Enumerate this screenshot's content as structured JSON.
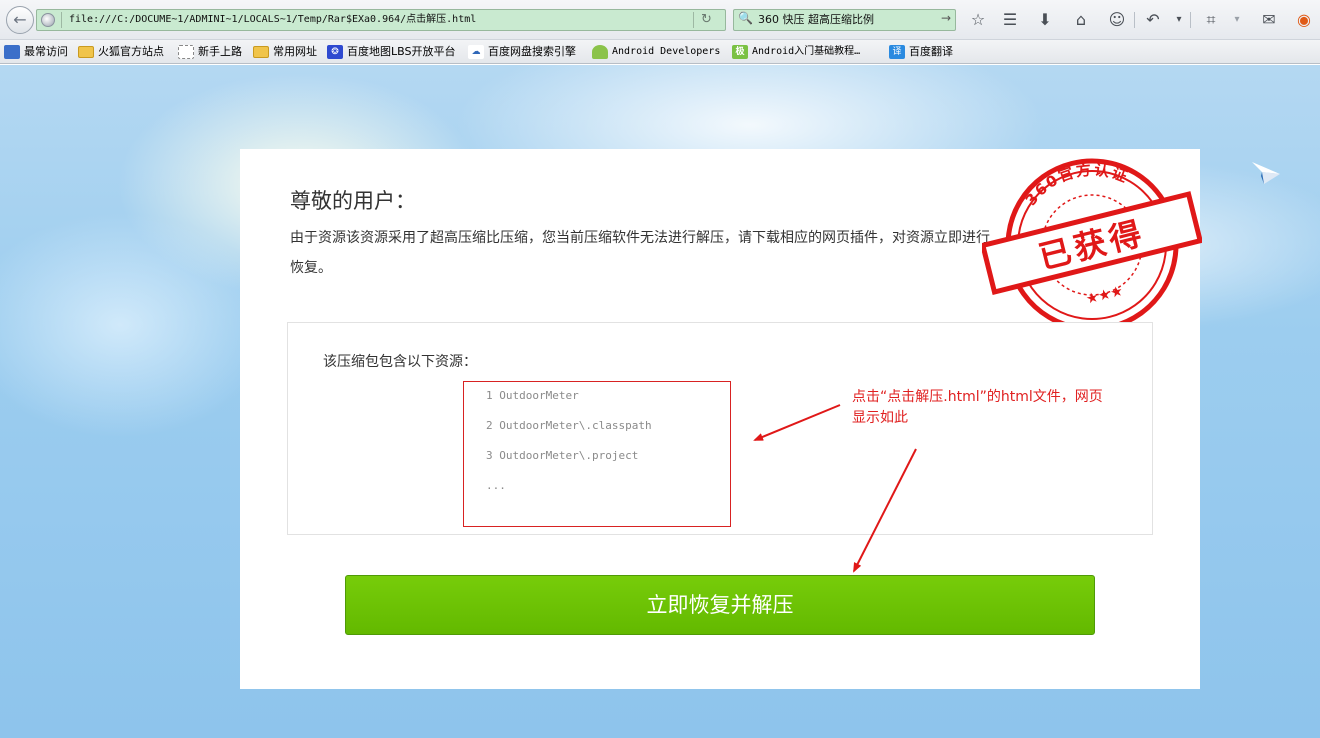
{
  "browser": {
    "url": "file:///C:/DOCUME~1/ADMINI~1/LOCALS~1/Temp/Rar$EXa0.964/点击解压.html",
    "search_text": "360 快压 超高压缩比例",
    "toolbar_icons": [
      "star-icon",
      "reader-icon",
      "download-icon",
      "home-icon",
      "chat-icon",
      "undo-icon",
      "crop-icon",
      "comment-icon",
      "weibo-icon"
    ]
  },
  "bookmarks": [
    {
      "label": "最常访问",
      "icon": "most-visited-icon"
    },
    {
      "label": "火狐官方站点",
      "icon": "folder-icon"
    },
    {
      "label": "新手上路",
      "icon": "dashed-page-icon"
    },
    {
      "label": "常用网址",
      "icon": "folder-icon"
    },
    {
      "label": "百度地图LBS开放平台",
      "icon": "baidu-paw-icon"
    },
    {
      "label": "百度网盘搜索引擎",
      "icon": "cloud-icon"
    },
    {
      "label": "Android Developers",
      "icon": "android-icon"
    },
    {
      "label": "Android入门基础教程…",
      "icon": "green-badge-icon"
    },
    {
      "label": "百度翻译",
      "icon": "translate-icon"
    }
  ],
  "page": {
    "greeting": "尊敬的用户：",
    "message": "由于资源该资源采用了超高压缩比压缩，您当前压缩软件无法进行解压，请下载相应的网页插件，对资源立即进行恢复。",
    "stamp": {
      "top_text": "360官方认证",
      "center_text": "已获得",
      "color": "#e01818"
    },
    "resource_title": "该压缩包包含以下资源：",
    "files": [
      "1 OutdoorMeter",
      "2 OutdoorMeter\\.classpath",
      "3 OutdoorMeter\\.project",
      "..."
    ],
    "annotation": "点击“点击解压.html”的html文件，网页显示如此",
    "button_label": "立即恢复并解压",
    "button_color": "#6cc304"
  }
}
